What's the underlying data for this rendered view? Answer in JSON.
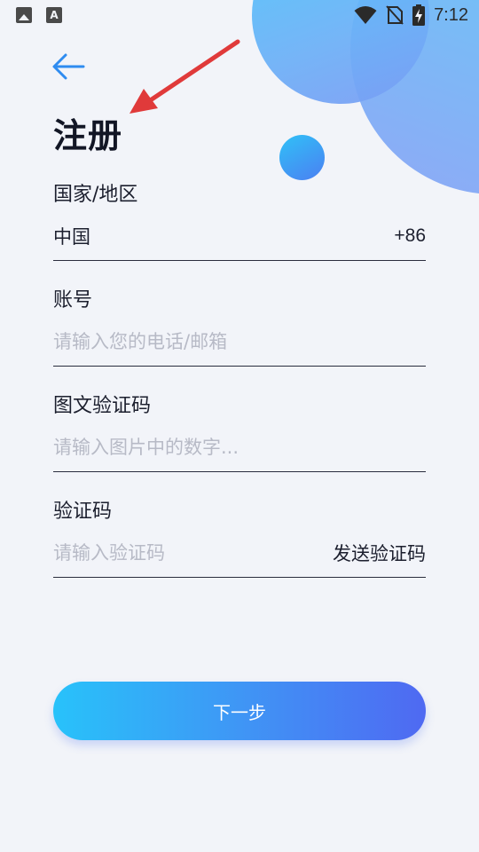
{
  "status_bar": {
    "time": "7:12",
    "left_icons": [
      "image-icon",
      "font-icon"
    ],
    "right_icons": [
      "wifi-icon",
      "no-sim-icon",
      "battery-charging-icon"
    ]
  },
  "header": {
    "back_icon": "arrow-left-icon",
    "title": "注册"
  },
  "form": {
    "region": {
      "label": "国家/地区",
      "value": "中国",
      "code": "+86"
    },
    "account": {
      "label": "账号",
      "placeholder": "请输入您的电话/邮箱",
      "value": ""
    },
    "captcha_image": {
      "label": "图文验证码",
      "placeholder": "请输入图片中的数字...",
      "value": ""
    },
    "verify_code": {
      "label": "验证码",
      "placeholder": "请输入验证码",
      "value": "",
      "send_label": "发送验证码"
    }
  },
  "next_button": {
    "label": "下一步"
  },
  "colors": {
    "accent_start": "#28c2fa",
    "accent_end": "#4f69f2",
    "background": "#f2f4f9",
    "annotation": "#e03a3a"
  }
}
